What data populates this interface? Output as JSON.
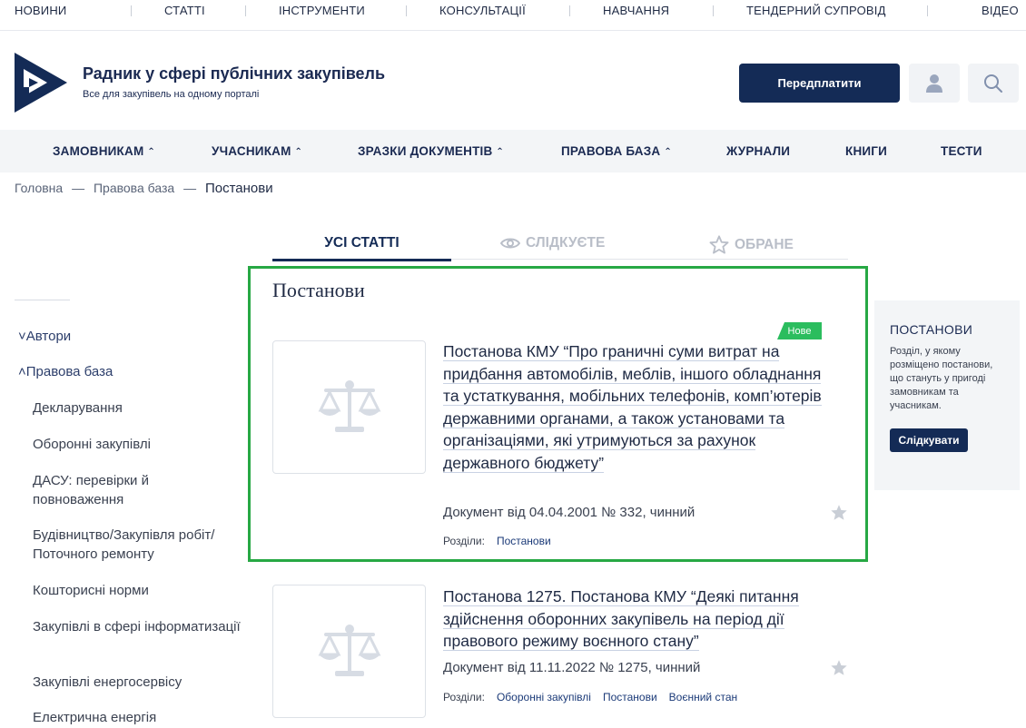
{
  "topnav": {
    "items": [
      "НОВИНИ",
      "СТАТТІ",
      "ІНСТРУМЕНТИ",
      "КОНСУЛЬТАЦІЇ",
      "НАВЧАННЯ",
      "ТЕНДЕРНИЙ СУПРОВІД",
      "ВІДЕО"
    ]
  },
  "header": {
    "title": "Радник у сфері публічних закупівель",
    "subtitle": "Все для закупівель на одному порталі",
    "subscribe_label": "Передплатити",
    "user_icon": "user-icon",
    "search_icon": "search-icon"
  },
  "mainnav": {
    "items": [
      {
        "label": "ЗАМОВНИКАМ",
        "caret": "^"
      },
      {
        "label": "УЧАСНИКАМ",
        "caret": "^"
      },
      {
        "label": "ЗРАЗКИ ДОКУМЕНТІВ",
        "caret": "^"
      },
      {
        "label": "ПРАВОВА БАЗА",
        "caret": "^"
      },
      {
        "label": "ЖУРНАЛИ",
        "caret": ""
      },
      {
        "label": "КНИГИ",
        "caret": ""
      },
      {
        "label": "ТЕСТИ",
        "caret": ""
      }
    ]
  },
  "breadcrumb": {
    "items": [
      "Головна",
      "Правова база",
      "Постанови"
    ],
    "separator": "—"
  },
  "tabs": [
    {
      "label": "УСІ СТАТТІ",
      "active": true
    },
    {
      "label": "СЛІДКУЄТЕ",
      "active": false,
      "icon": "eye-icon"
    },
    {
      "label": "ОБРАНЕ",
      "active": false,
      "icon": "star-icon"
    }
  ],
  "sidebar": {
    "top_items": [
      {
        "label": "Автори",
        "caret": "˅"
      },
      {
        "label": "Правова база",
        "caret": "˄"
      }
    ],
    "sub_items": [
      "Декларування",
      "Оборонні закупівлі",
      "ДАСУ: перевірки й повноваження",
      "Будівництво/Закупівля робіт/ Поточного ремонту",
      "Кошторисні норми",
      "Закупівлі в сфері інформатизації",
      "Закупівлі енергосервісу",
      "Електрична енергія"
    ]
  },
  "section": {
    "title": "Постанови"
  },
  "articles": [
    {
      "badge": "Нове",
      "title": "Постанова КМУ “Про граничні суми витрат на придбання автомобілів, меблів, іншого обладнання та устаткування, мобільних телефонів, комп’ютерів державними органами, а також установами та організаціями, які утримуються за рахунок державного бюджету”",
      "meta": "Документ від 04.04.2001 № 332, чинний",
      "sections_label": "Розділи:",
      "sections": [
        "Постанови"
      ]
    },
    {
      "badge": "",
      "title": "Постанова 1275. Постанова КМУ “Деякі питання здійснення оборонних закупівель на період дії правового режиму воєнного стану”",
      "meta": "Документ від 11.11.2022 № 1275, чинний",
      "sections_label": "Розділи:",
      "sections": [
        "Оборонні закупівлі",
        "Постанови",
        "Воєнний стан"
      ]
    }
  ],
  "rightbox": {
    "title": "ПОСТАНОВИ",
    "description": "Розділ, у якому розміщено постанови, що стануть у пригоді замовникам та учасникам.",
    "follow_label": "Слідкувати"
  },
  "colors": {
    "brand": "#142b56",
    "highlight": "#27a844",
    "badge": "#2bbd5e"
  }
}
